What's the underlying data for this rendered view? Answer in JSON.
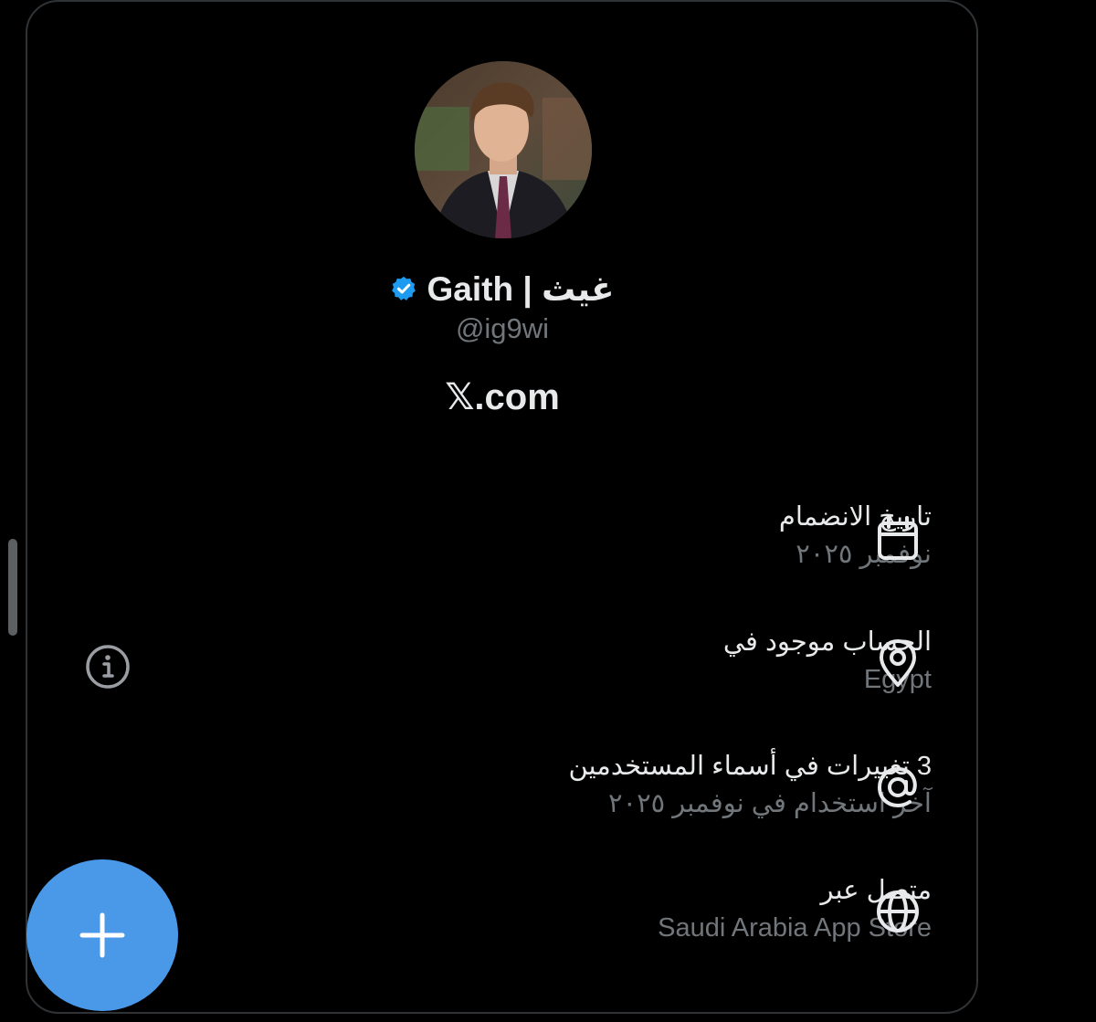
{
  "profile": {
    "display_name": "Gaith | غيث",
    "handle": "@ig9wi",
    "website": "𝕏.com",
    "verified_icon": "verified-badge-icon"
  },
  "about": {
    "rows": [
      {
        "icon": "calendar-icon",
        "title": "تاريخ الانضمام",
        "subtitle": "نوفمبر ٢٠٢٥"
      },
      {
        "icon": "location-pin-icon",
        "title": "الحساب موجود في",
        "subtitle": "Egypt"
      },
      {
        "icon": "at-sign-icon",
        "title": "3 تغييرات في أسماء المستخدمين",
        "subtitle": "آخر استخدام في نوفمبر ٢٠٢٥"
      },
      {
        "icon": "globe-icon",
        "title": "متصل عبر",
        "subtitle": "Saudi Arabia App Store"
      }
    ]
  },
  "colors": {
    "background": "#000000",
    "primary_text": "#e7e9ea",
    "secondary_text": "#71767b",
    "accent": "#4a99e9",
    "verified": "#1d9bf0"
  }
}
